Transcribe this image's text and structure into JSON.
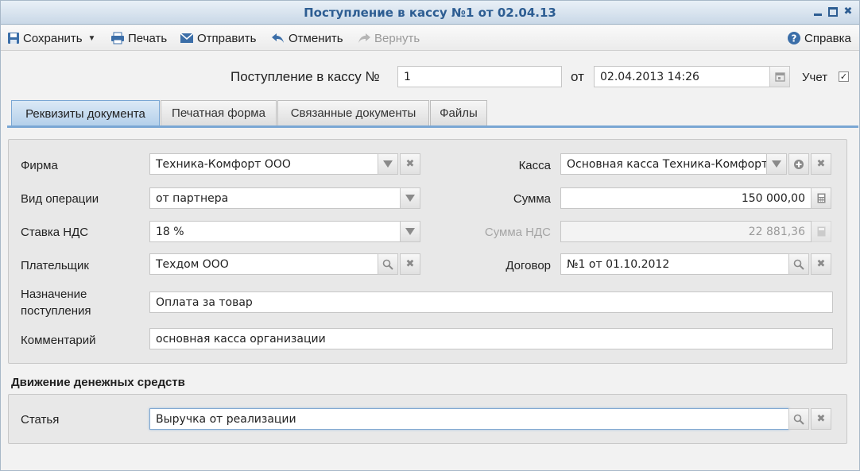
{
  "window": {
    "title": "Поступление в кассу №1 от 02.04.13"
  },
  "toolbar": {
    "save_label": "Сохранить",
    "print_label": "Печать",
    "send_label": "Отправить",
    "undo_label": "Отменить",
    "redo_label": "Вернуть",
    "help_label": "Справка"
  },
  "header": {
    "doc_label": "Поступление в кассу №",
    "doc_number": "1",
    "from_label": "от",
    "date_value": "02.04.2013 14:26",
    "accounting_label": "Учет",
    "accounting_checked": true
  },
  "tabs": [
    {
      "label": "Реквизиты документа",
      "active": true
    },
    {
      "label": "Печатная форма",
      "active": false
    },
    {
      "label": "Связанные документы",
      "active": false
    },
    {
      "label": "Файлы",
      "active": false
    }
  ],
  "form": {
    "firm_label": "Фирма",
    "firm_value": "Техника-Комфорт ООО",
    "operation_label": "Вид операции",
    "operation_value": "от партнера",
    "vat_rate_label": "Ставка НДС",
    "vat_rate_value": "18 %",
    "payer_label": "Плательщик",
    "payer_value": "Техдом ООО",
    "purpose_label_line1": "Назначение",
    "purpose_label_line2": "поступления",
    "purpose_value": "Оплата за товар",
    "comment_label": "Комментарий",
    "comment_value": "основная касса организации",
    "cashbox_label": "Касса",
    "cashbox_value": "Основная касса Техника-Комфорт",
    "sum_label": "Сумма",
    "sum_value": "150 000,00",
    "vat_sum_label": "Сумма НДС",
    "vat_sum_value": "22 881,36",
    "contract_label": "Договор",
    "contract_value": "№1 от 01.10.2012"
  },
  "cashflow": {
    "section_title": "Движение денежных средств",
    "article_label": "Статья",
    "article_value": "Выручка от реализации"
  },
  "colors": {
    "title_text": "#2d5d92",
    "tab_active": "#b3cfea",
    "accent_line": "#7aa7d4"
  }
}
